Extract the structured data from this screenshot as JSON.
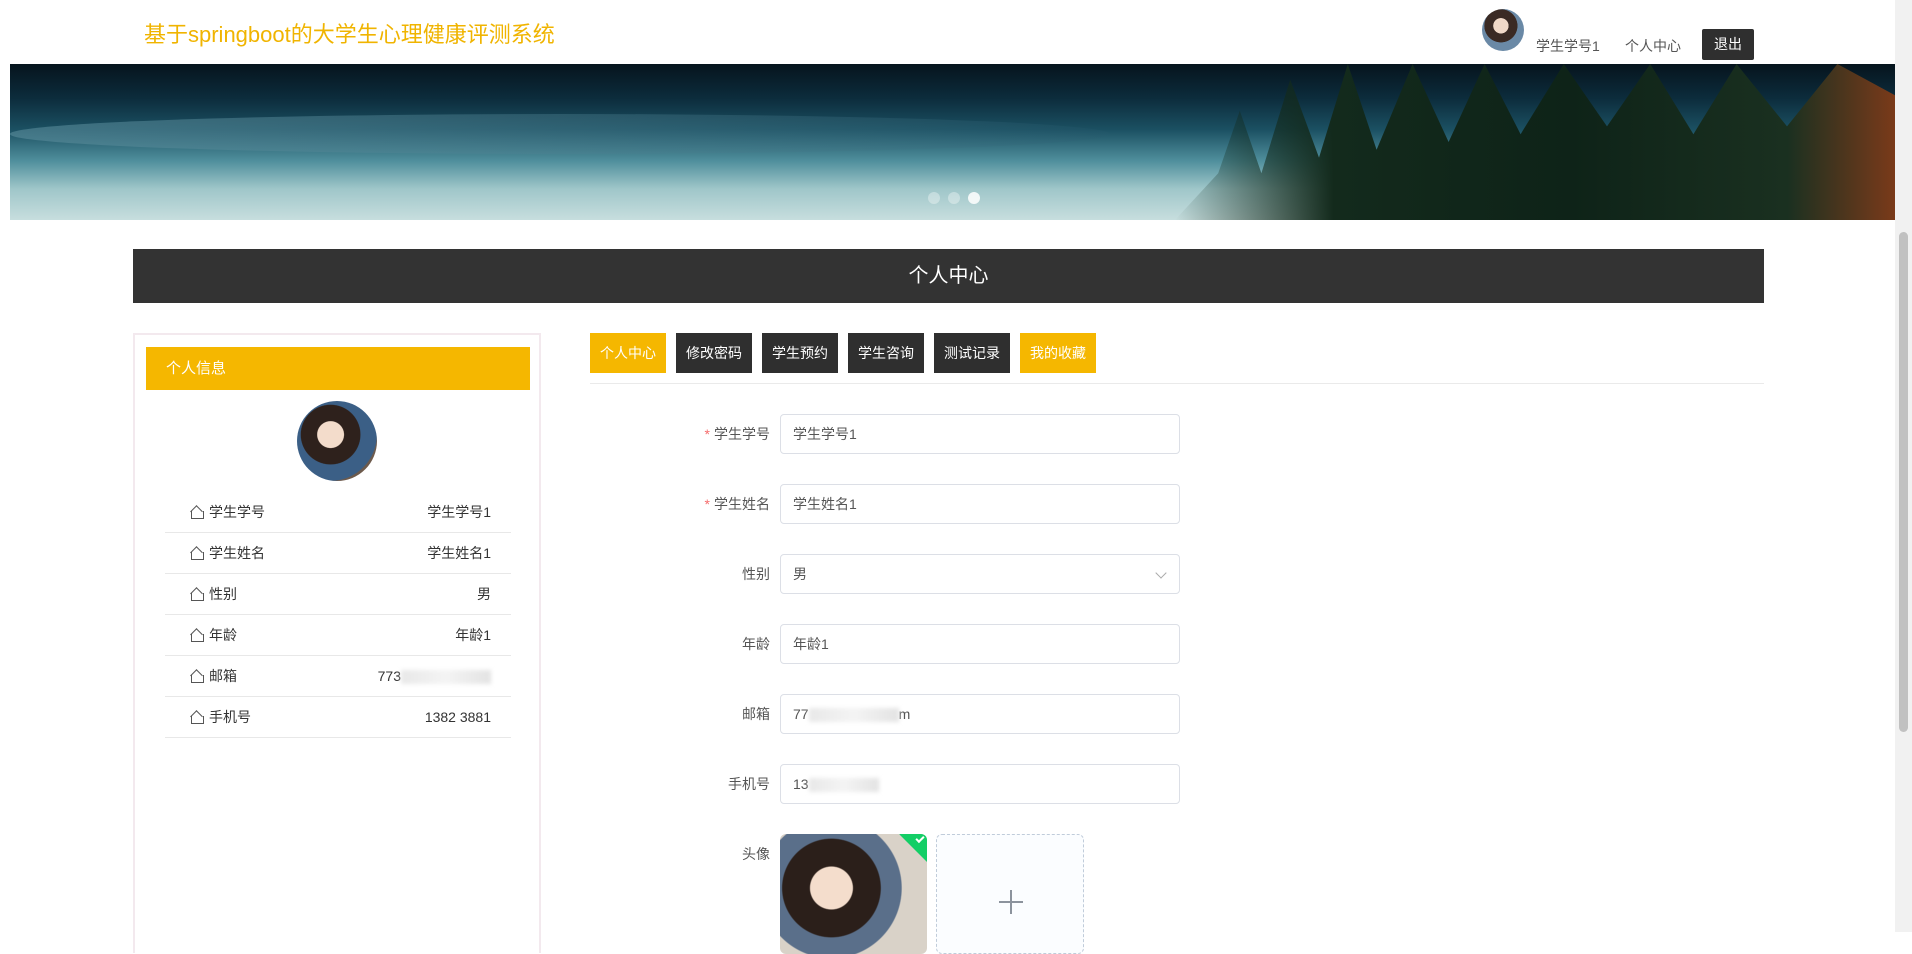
{
  "header": {
    "site_title": "基于springboot的大学生心理健康评测系统",
    "username": "学生学号1",
    "personal_center": "个人中心",
    "logout": "退出"
  },
  "banner": {
    "slides": 3,
    "active_slide": 3
  },
  "page": {
    "title": "个人中心"
  },
  "info_card": {
    "title": "个人信息",
    "rows": [
      {
        "label": "学生学号",
        "value": "学生学号1"
      },
      {
        "label": "学生姓名",
        "value": "学生姓名1"
      },
      {
        "label": "性别",
        "value": "男"
      },
      {
        "label": "年龄",
        "value": "年龄1"
      },
      {
        "label": "邮箱",
        "value": "773"
      },
      {
        "label": "手机号",
        "value": "1382  3881"
      }
    ]
  },
  "tabs": [
    {
      "label": "个人中心",
      "active": true
    },
    {
      "label": "修改密码",
      "active": false
    },
    {
      "label": "学生预约",
      "active": false
    },
    {
      "label": "学生咨询",
      "active": false
    },
    {
      "label": "测试记录",
      "active": false
    },
    {
      "label": "我的收藏",
      "active": false
    }
  ],
  "form": {
    "student_no": {
      "label": "学生学号",
      "value": "学生学号1",
      "required": true
    },
    "student_name": {
      "label": "学生姓名",
      "value": "学生姓名1",
      "required": true
    },
    "gender": {
      "label": "性别",
      "value": "男"
    },
    "age": {
      "label": "年龄",
      "value": "年龄1"
    },
    "email": {
      "label": "邮箱",
      "value_start": "77",
      "value_end": "m"
    },
    "phone": {
      "label": "手机号",
      "value_start": "13"
    },
    "avatar": {
      "label": "头像"
    }
  },
  "colors": {
    "accent": "#f5b700",
    "title": "#f0b400",
    "dark": "#2f2f2f",
    "success": "#13ce66"
  }
}
